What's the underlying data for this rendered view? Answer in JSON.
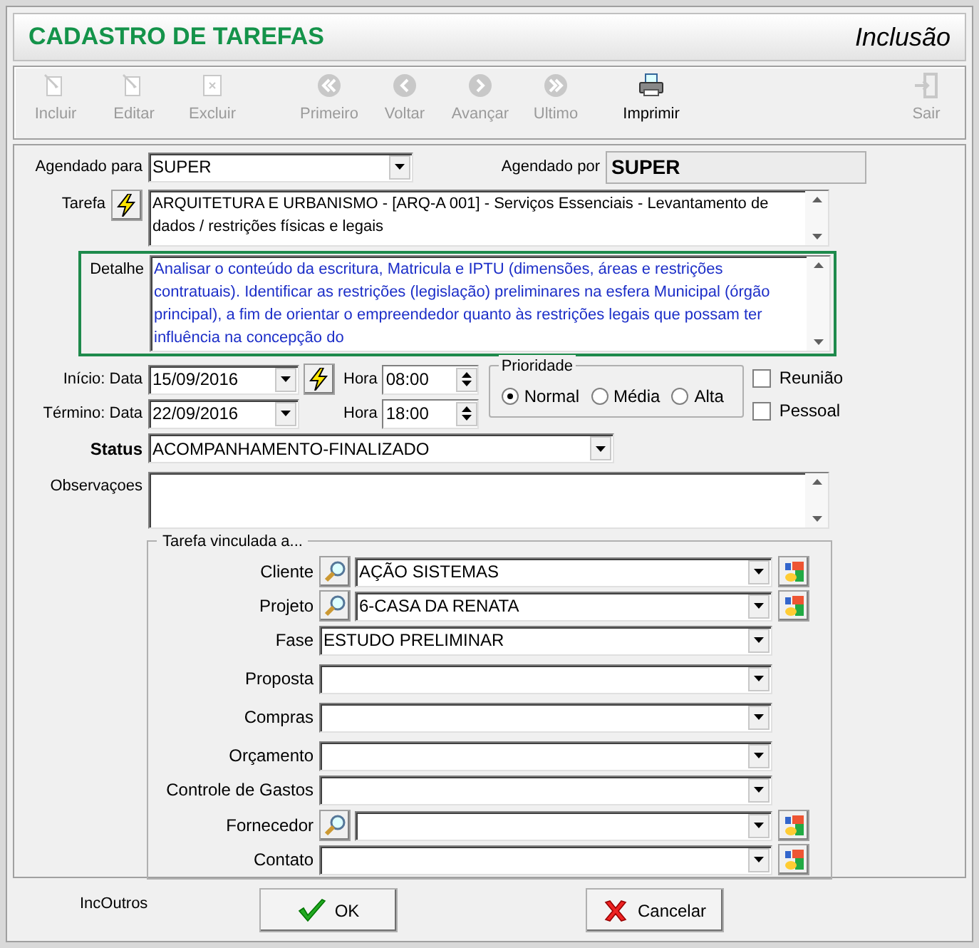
{
  "window": {
    "title": "CADASTRO DE TAREFAS",
    "mode": "Inclusão"
  },
  "toolbar": [
    {
      "label": "Incluir",
      "disabled": true
    },
    {
      "label": "Editar",
      "disabled": true
    },
    {
      "label": "Excluir",
      "disabled": true
    },
    {
      "label": "Primeiro",
      "disabled": true
    },
    {
      "label": "Voltar",
      "disabled": true
    },
    {
      "label": "Avançar",
      "disabled": true
    },
    {
      "label": "Ultimo",
      "disabled": true
    },
    {
      "label": "Imprimir",
      "disabled": false
    },
    {
      "label": "Sair",
      "disabled": true
    }
  ],
  "agendado_para": {
    "label": "Agendado para",
    "value": "SUPER"
  },
  "agendado_por": {
    "label": "Agendado por",
    "value": "SUPER"
  },
  "tarefa": {
    "label": "Tarefa",
    "value": "ARQUITETURA E URBANISMO - [ARQ-A 001]  - Serviços Essenciais - Levantamento de dados / restrições físicas e legais"
  },
  "detalhe": {
    "label": "Detalhe",
    "value": "Analisar o conteúdo da escritura, Matricula e IPTU (dimensões, áreas e restrições contratuais). Identificar as restrições (legislação) preliminares na esfera Municipal (órgão principal), a fim de orientar o empreendedor quanto às restrições legais que possam ter influência na concepção do"
  },
  "inicio": {
    "label": "Início: Data",
    "date": "15/09/2016",
    "hora_label": "Hora",
    "hora": "08:00"
  },
  "termino": {
    "label": "Término: Data",
    "date": "22/09/2016",
    "hora_label": "Hora",
    "hora": "18:00"
  },
  "prioridade": {
    "label": "Prioridade",
    "options": [
      {
        "label": "Normal",
        "selected": true
      },
      {
        "label": "Média",
        "selected": false
      },
      {
        "label": "Alta",
        "selected": false
      }
    ]
  },
  "flags": [
    {
      "label": "Reunião",
      "checked": false
    },
    {
      "label": "Pessoal",
      "checked": false
    }
  ],
  "status": {
    "label": "Status",
    "value": "ACOMPANHAMENTO-FINALIZADO"
  },
  "observacoes": {
    "label": "Observaçoes"
  },
  "vinculada": {
    "title": "Tarefa vinculada a...",
    "rows": [
      {
        "label": "Cliente",
        "value": "AÇÃO SISTEMAS",
        "search": true,
        "map": true
      },
      {
        "label": "Projeto",
        "value": "6-CASA DA RENATA",
        "search": true,
        "map": true
      },
      {
        "label": "Fase",
        "value": "ESTUDO PRELIMINAR",
        "search": false,
        "map": false
      },
      {
        "label": "Proposta",
        "value": "",
        "search": false,
        "map": false
      },
      {
        "label": "Compras",
        "value": "",
        "search": false,
        "map": false
      },
      {
        "label": "Orçamento",
        "value": "",
        "search": false,
        "map": false
      },
      {
        "label": "Controle de Gastos",
        "value": "",
        "search": false,
        "map": false
      },
      {
        "label": "Fornecedor",
        "value": "",
        "search": true,
        "map": true
      },
      {
        "label": "Contato",
        "value": "",
        "search": false,
        "map": true
      }
    ]
  },
  "footer": {
    "note": "IncOutros",
    "buttons": [
      {
        "label": "OK",
        "kind": "ok"
      },
      {
        "label": "Cancelar",
        "kind": "cancel"
      }
    ]
  }
}
